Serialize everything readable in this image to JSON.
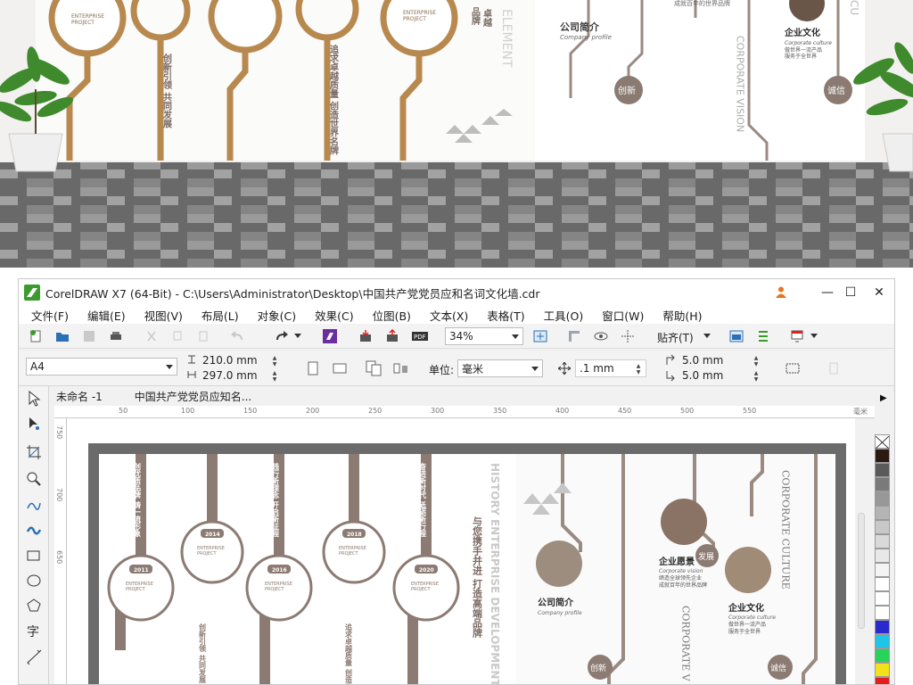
{
  "render": {
    "panel_labels": {
      "project_en": "ENTERPRISE\nPROJECT",
      "innovate_left": "创新引领 共同发展",
      "pursue": "追求卓越质量 创造世界名牌",
      "thumb_excellent": "卓越\n品牌",
      "development_en": "ELEMENT",
      "company_profile_cn": "公司简介",
      "company_profile_en": "Company profile",
      "vision_en": "CORPORATE VISION",
      "innovate": "创新",
      "culture_cn": "企业文化",
      "culture_en": "Corporate culture",
      "culture_line": "做世界一流产品",
      "culture_line2": "服务于全世界",
      "vision_line": "成就百年的世界品牌",
      "integrity": "诚信"
    }
  },
  "window": {
    "title": "CorelDRAW X7 (64-Bit) - C:\\Users\\Administrator\\Desktop\\中国共产党党员应和名词文化墙.cdr",
    "minimize": "—",
    "maximize": "☐",
    "close": "✕"
  },
  "menu": [
    "文件(F)",
    "编辑(E)",
    "视图(V)",
    "布局(L)",
    "对象(C)",
    "效果(C)",
    "位图(B)",
    "文本(X)",
    "表格(T)",
    "工具(O)",
    "窗口(W)",
    "帮助(H)"
  ],
  "toolbar1": {
    "zoom": "34%",
    "snap_label": "贴齐(T)"
  },
  "toolbar2": {
    "page_size": "A4",
    "width": "210.0 mm",
    "height": "297.0 mm",
    "unit_label": "单位:",
    "unit_value": "毫米",
    "nudge": ".1 mm",
    "dup_x": "5.0 mm",
    "dup_y": "5.0 mm"
  },
  "doc_tabs": [
    "未命名 -1",
    "中国共产党党员应知名..."
  ],
  "ruler": {
    "h_ticks": [
      "50",
      "100",
      "150",
      "200",
      "250",
      "300",
      "350",
      "400",
      "450",
      "500",
      "550",
      "毫米"
    ],
    "v_ticks": [
      "750",
      "700",
      "650"
    ]
  },
  "canvas": {
    "years": [
      "2011",
      "2014",
      "2016",
      "2018",
      "2020"
    ],
    "project_en": "ENTERPRISE\nPROJECT",
    "vertical_texts": [
      "创优质品牌 铸一流形象",
      "践行新理念 开启新征程",
      "奋进新时代 砥砺新行程",
      "与您携手并进 打造高端品牌"
    ],
    "bottom_texts": [
      "创新引领 共同发展",
      "追求卓越质量 创造世界名牌"
    ],
    "history_en": "HISTORY ENTERPRISE DEVELOPMENT",
    "company_profile_cn": "公司简介",
    "company_profile_en": "Company profile",
    "vision_cn": "企业愿景",
    "vision_en": "Corporate vision",
    "vision_line1": "缔造全球领先企业",
    "vision_line2": "成就百年的世界品牌",
    "culture_cn": "企业文化",
    "culture_en": "Corporate culture",
    "culture_line1": "做世界一流产品",
    "culture_line2": "服务于全世界",
    "corporate_culture_en": "CORPORATE CULTURE",
    "corporate_vision_en": "CORPORATE V",
    "develop": "发展",
    "innovate": "创新",
    "integrity": "诚信"
  },
  "palette": [
    "#2b1a12",
    "#5a5a5a",
    "#7a7a7a",
    "#989898",
    "#b4b4b4",
    "#c8c8c8",
    "#d9d9d9",
    "#e8e8e8",
    "#f4f4f4",
    "#ffffff",
    "#ffffff",
    "#ffffff",
    "#2a2acc",
    "#1fc4e6",
    "#27d35a",
    "#f3e21a",
    "#e61d1d"
  ],
  "colors": {
    "wood": "#b8894f",
    "pipe_gray": "#8c7b72",
    "accent": "#7a6a63"
  }
}
